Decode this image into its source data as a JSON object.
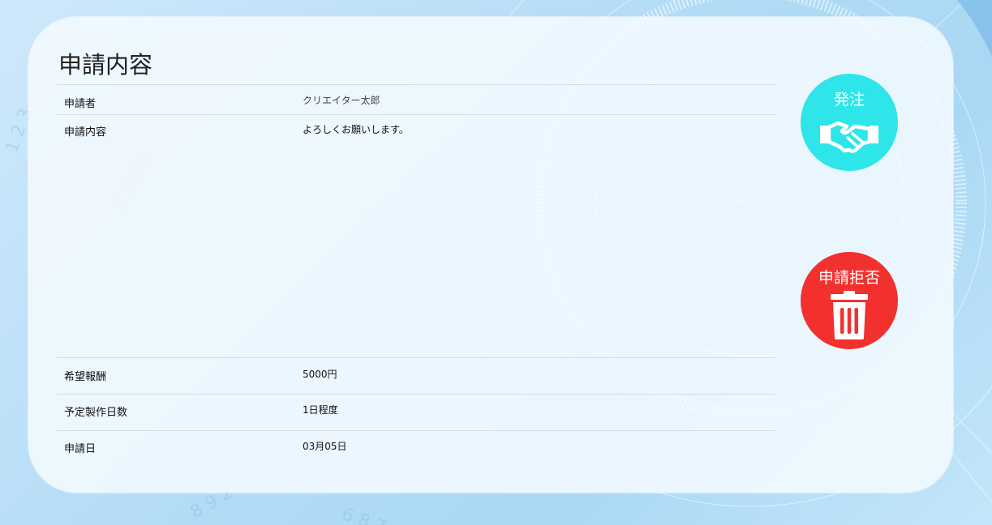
{
  "page": {
    "title": "申請内容"
  },
  "details": {
    "applicant_label": "申請者",
    "applicant_value": "クリエイター太郎",
    "content_label": "申請内容",
    "content_value": "よろしくお願いします。",
    "reward_label": "希望報酬",
    "reward_value": "5000円",
    "days_label": "予定製作日数",
    "days_value": "1日程度",
    "date_label": "申請日",
    "date_value": "03月05日"
  },
  "actions": {
    "order_label": "発注",
    "order_icon": "handshake-icon",
    "order_color": "#2ee6ea",
    "reject_label": "申請拒否",
    "reject_icon": "trash-icon",
    "reject_color": "#f2312f"
  }
}
